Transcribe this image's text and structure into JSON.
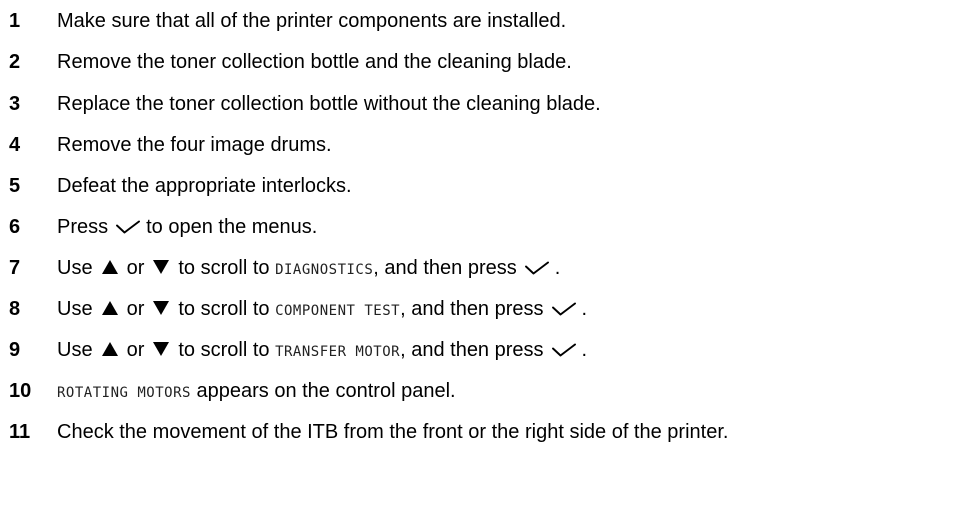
{
  "steps": [
    {
      "number": "1",
      "parts": [
        {
          "t": "Make sure that all of the printer components are installed."
        }
      ]
    },
    {
      "number": "2",
      "parts": [
        {
          "t": "Remove the toner collection bottle and the cleaning blade."
        }
      ]
    },
    {
      "number": "3",
      "parts": [
        {
          "t": "Replace the toner collection bottle without the cleaning blade."
        }
      ]
    },
    {
      "number": "4",
      "parts": [
        {
          "t": "Remove the four image drums."
        }
      ]
    },
    {
      "number": "5",
      "parts": [
        {
          "t": "Defeat the appropriate interlocks."
        }
      ]
    },
    {
      "number": "6",
      "parts": [
        {
          "t": "Press"
        },
        {
          "icon": "check-icon"
        },
        {
          "t": "to open the menus."
        }
      ]
    },
    {
      "number": "7",
      "parts": [
        {
          "t": "Use"
        },
        {
          "icon": "up-arrow-icon"
        },
        {
          "t": "or"
        },
        {
          "icon": "down-arrow-icon"
        },
        {
          "t": "to scroll to "
        },
        {
          "lcd": "DIAGNOSTICS"
        },
        {
          "t": ", and then press"
        },
        {
          "icon": "check-icon"
        },
        {
          "t": "."
        }
      ]
    },
    {
      "number": "8",
      "parts": [
        {
          "t": "Use"
        },
        {
          "icon": "up-arrow-icon"
        },
        {
          "t": "or"
        },
        {
          "icon": "down-arrow-icon"
        },
        {
          "t": "to scroll to "
        },
        {
          "lcd": "COMPONENT TEST"
        },
        {
          "t": ", and then press"
        },
        {
          "icon": "check-icon"
        },
        {
          "t": "."
        }
      ]
    },
    {
      "number": "9",
      "parts": [
        {
          "t": "Use"
        },
        {
          "icon": "up-arrow-icon"
        },
        {
          "t": "or"
        },
        {
          "icon": "down-arrow-icon"
        },
        {
          "t": "to scroll to "
        },
        {
          "lcd": "TRANSFER MOTOR"
        },
        {
          "t": ", and then press"
        },
        {
          "icon": "check-icon"
        },
        {
          "t": "."
        }
      ]
    },
    {
      "number": "10",
      "parts": [
        {
          "lcd": "ROTATING MOTORS"
        },
        {
          "t": " appears on the control panel."
        }
      ]
    },
    {
      "number": "11",
      "parts": [
        {
          "t": "Check the movement of the ITB from the front or the right side of the printer."
        }
      ]
    }
  ]
}
